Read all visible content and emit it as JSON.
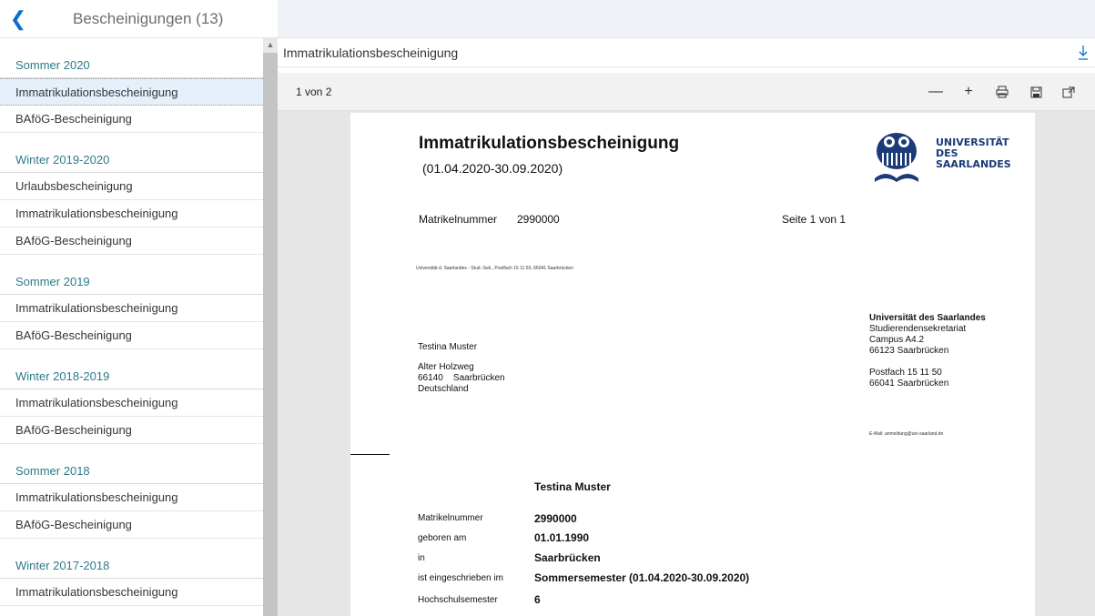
{
  "left": {
    "title": "Bescheinigungen (13)",
    "groups": [
      {
        "title": "Sommer 2020",
        "items": [
          "Immatrikulationsbescheinigung",
          "BAföG-Bescheinigung"
        ]
      },
      {
        "title": "Winter 2019-2020",
        "items": [
          "Urlaubsbescheinigung",
          "Immatrikulationsbescheinigung",
          "BAföG-Bescheinigung"
        ]
      },
      {
        "title": "Sommer 2019",
        "items": [
          "Immatrikulationsbescheinigung",
          "BAföG-Bescheinigung"
        ]
      },
      {
        "title": "Winter 2018-2019",
        "items": [
          "Immatrikulationsbescheinigung",
          "BAföG-Bescheinigung"
        ]
      },
      {
        "title": "Sommer 2018",
        "items": [
          "Immatrikulationsbescheinigung",
          "BAföG-Bescheinigung"
        ]
      },
      {
        "title": "Winter 2017-2018",
        "items": [
          "Immatrikulationsbescheinigung"
        ]
      }
    ]
  },
  "doc": {
    "title": "Immatrikulationsbescheinigung",
    "page_count": "1 von 2"
  },
  "paper": {
    "title": "Immatrikulationsbescheinigung",
    "period": "(01.04.2020-30.09.2020)",
    "logo": [
      "UNIVERSITÄT",
      "DES",
      "SAARLANDES"
    ],
    "mat_label": "Matrikelnummer",
    "mat_value": "2990000",
    "seite": "Seite 1 von 1",
    "sender": "Universität d. Saarlandes - Stud.-Sek., Postfach 15 11 50, 66041 Saarbrücken",
    "recipient_name": "Testina Muster",
    "addr1": "Alter Holzweg",
    "addr2": "66140    Saarbrücken",
    "addr3": "Deutschland",
    "uni1": "Universität des Saarlandes",
    "uni2": "Studierendensekretariat",
    "uni3": "Campus A4.2",
    "uni4": "66123 Saarbrücken",
    "uni5": "Postfach 15 11 50",
    "uni6": "66041 Saarbrücken",
    "email": "E-Mail: anmeldung@uni-saarland.de",
    "big_name": "Testina Muster",
    "rows": [
      {
        "label": "Matrikelnummer",
        "value": "2990000"
      },
      {
        "label": "geboren am",
        "value": "01.01.1990"
      },
      {
        "label": "in",
        "value": "Saarbrücken"
      },
      {
        "label": "ist eingeschrieben im",
        "value": "Sommersemester (01.04.2020-30.09.2020)"
      },
      {
        "label": "Hochschulsemester",
        "value": "6"
      }
    ]
  },
  "colors": {
    "accent": "#0a6ed1",
    "group": "#2c7b8a",
    "selected": "#e5f0fa"
  },
  "icons": [
    "back-icon",
    "download-icon",
    "zoom-out-icon",
    "zoom-in-icon",
    "print-icon",
    "save-icon",
    "open-external-icon"
  ]
}
